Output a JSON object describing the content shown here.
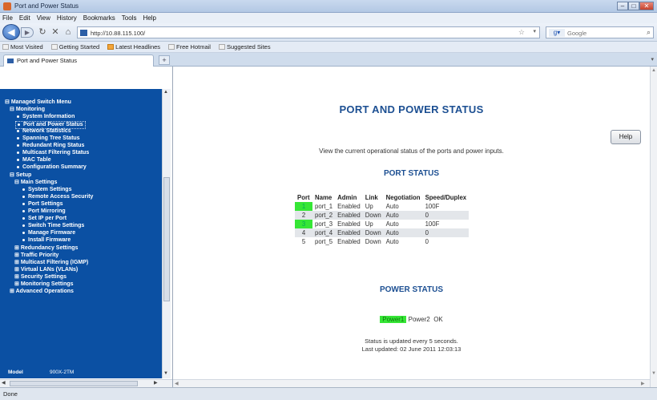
{
  "window": {
    "title": "Port and Power Status"
  },
  "menu": [
    "File",
    "Edit",
    "View",
    "History",
    "Bookmarks",
    "Tools",
    "Help"
  ],
  "nav": {
    "url": "http://10.88.115.100/",
    "search_engine": "Google",
    "search_placeholder": "Google"
  },
  "bookmarks": [
    "Most Visited",
    "Getting Started",
    "Latest Headlines",
    "Free Hotmail",
    "Suggested Sites"
  ],
  "tab": {
    "title": "Port and Power Status"
  },
  "sidebar": {
    "items": [
      {
        "label": "Managed Switch Menu",
        "prefix": "⊟"
      },
      {
        "label": "Monitoring",
        "prefix": "⊟"
      },
      {
        "label": "System Information",
        "prefix": "•"
      },
      {
        "label": "Port and Power Status",
        "prefix": "•",
        "current": true
      },
      {
        "label": "Network Statistics",
        "prefix": "•"
      },
      {
        "label": "Spanning Tree Status",
        "prefix": "•"
      },
      {
        "label": "Redundant Ring Status",
        "prefix": "•"
      },
      {
        "label": "Multicast Filtering Status",
        "prefix": "•"
      },
      {
        "label": "MAC Table",
        "prefix": "•"
      },
      {
        "label": "Configuration Summary",
        "prefix": "•"
      },
      {
        "label": "Setup",
        "prefix": "⊟"
      },
      {
        "label": "Main Settings",
        "prefix": "⊟"
      },
      {
        "label": "System Settings",
        "prefix": "•"
      },
      {
        "label": "Remote Access Security",
        "prefix": "•"
      },
      {
        "label": "Port Settings",
        "prefix": "•"
      },
      {
        "label": "Port Mirroring",
        "prefix": "•"
      },
      {
        "label": "Set IP per Port",
        "prefix": "•"
      },
      {
        "label": "Switch Time Settings",
        "prefix": "•"
      },
      {
        "label": "Manage Firmware",
        "prefix": "•"
      },
      {
        "label": "Install Firmware",
        "prefix": "•"
      },
      {
        "label": "Redundancy Settings",
        "prefix": "⊞"
      },
      {
        "label": "Traffic Priority",
        "prefix": "⊞"
      },
      {
        "label": "Multicast Filtering (IGMP)",
        "prefix": "⊞"
      },
      {
        "label": "Virtual LANs (VLANs)",
        "prefix": "⊞"
      },
      {
        "label": "Security Settings",
        "prefix": "⊞"
      },
      {
        "label": "Monitoring Settings",
        "prefix": "⊞"
      },
      {
        "label": "Advanced Operations",
        "prefix": "⊞"
      }
    ],
    "model_label": "Model",
    "model_value": "900X-2TM"
  },
  "main": {
    "title": "PORT AND POWER STATUS",
    "help_label": "Help",
    "description": "View the current operational status of the ports and power inputs.",
    "port_status_title": "PORT STATUS",
    "port_table": {
      "headers": [
        "Port",
        "Name",
        "Admin",
        "Link",
        "Negotiation",
        "Speed/Duplex"
      ],
      "rows": [
        [
          "1",
          "port_1",
          "Enabled",
          "Up",
          "Auto",
          "100F"
        ],
        [
          "2",
          "port_2",
          "Enabled",
          "Down",
          "Auto",
          "0"
        ],
        [
          "3",
          "port_3",
          "Enabled",
          "Up",
          "Auto",
          "100F"
        ],
        [
          "4",
          "port_4",
          "Enabled",
          "Down",
          "Auto",
          "0"
        ],
        [
          "5",
          "port_5",
          "Enabled",
          "Down",
          "Auto",
          "0"
        ]
      ],
      "link_up_color": "#36e636"
    },
    "power_status_title": "POWER STATUS",
    "power": {
      "power1": "Power1",
      "power2": "Power2",
      "status": "OK"
    },
    "update_note": "Status is updated every 5 seconds.",
    "last_updated": "Last updated: 02 June 2011 12:03:13"
  },
  "status_bar": {
    "text": "Done"
  },
  "colors": {
    "sidebar_bg": "#0b50a3",
    "heading": "#1c4f92",
    "status_green": "#36e636"
  },
  "icons": [
    "back-icon",
    "forward-icon",
    "reload-icon",
    "stop-icon",
    "home-icon",
    "star-icon",
    "search-icon"
  ]
}
